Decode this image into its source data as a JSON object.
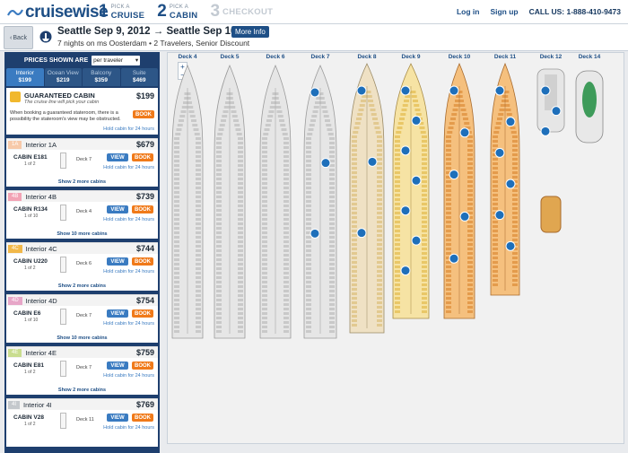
{
  "brand": {
    "logo_text": "cruisewise",
    "accent": "#1e4f86",
    "book_color": "#f07a1a"
  },
  "steps": [
    {
      "num": "1",
      "small": "PICK A",
      "big": "CRUISE"
    },
    {
      "num": "2",
      "small": "PICK A",
      "big": "CABIN"
    },
    {
      "num": "3",
      "small": "",
      "big": "CHECKOUT"
    }
  ],
  "top_links": {
    "login": "Log in",
    "signup": "Sign up",
    "phone": "CALL US: 1-888-410-9473"
  },
  "trip": {
    "back_label": "Back",
    "title": "Seattle Sep 9, 2012 → Seattle Sep 16, 2012",
    "more_info": "More Info",
    "subtitle": "7 nights on ms Oosterdam  •  2 Travelers, Senior Discount"
  },
  "sidebar": {
    "prices_label": "PRICES SHOWN ARE",
    "prices_option": "per traveler",
    "tabs": [
      {
        "name": "Interior",
        "price": "$199"
      },
      {
        "name": "Ocean View",
        "price": "$219"
      },
      {
        "name": "Balcony",
        "price": "$359"
      },
      {
        "name": "Suite",
        "price": "$469"
      }
    ],
    "guarantee": {
      "title": "GUARANTEED CABIN",
      "price": "$199",
      "subtitle": "The cruise line will pick your cabin",
      "desc": "When booking a guaranteed stateroom, there is a possibility the stateroom's view may be obstructed.",
      "book": "BOOK",
      "hold": "Hold cabin for 24 hours"
    },
    "cards": [
      {
        "code": "1A",
        "code_color": "#f7c9a9",
        "name": "Interior 1A",
        "price": "$679",
        "cabin": "CABIN E181",
        "of": "1 of 2",
        "deck": "Deck 7",
        "view": "VIEW",
        "book": "BOOK",
        "hold": "Hold cabin for 24 hours",
        "more": "Show 2 more cabins"
      },
      {
        "code": "4B",
        "code_color": "#f2a3b5",
        "name": "Interior 4B",
        "price": "$739",
        "cabin": "CABIN R134",
        "of": "1 of 10",
        "deck": "Deck 4",
        "view": "VIEW",
        "book": "BOOK",
        "hold": "Hold cabin for 24 hours",
        "more": "Show 10 more cabins"
      },
      {
        "code": "4C",
        "code_color": "#f1b84a",
        "name": "Interior 4C",
        "price": "$744",
        "cabin": "CABIN U220",
        "of": "1 of 2",
        "deck": "Deck 6",
        "view": "VIEW",
        "book": "BOOK",
        "hold": "Hold cabin for 24 hours",
        "more": "Show 2 more cabins"
      },
      {
        "code": "4D",
        "code_color": "#e7a6c8",
        "name": "Interior 4D",
        "price": "$754",
        "cabin": "CABIN E6",
        "of": "1 of 10",
        "deck": "Deck 7",
        "view": "VIEW",
        "book": "BOOK",
        "hold": "Hold cabin for 24 hours",
        "more": "Show 10 more cabins"
      },
      {
        "code": "4E",
        "code_color": "#c9dd8f",
        "name": "Interior 4E",
        "price": "$759",
        "cabin": "CABIN E81",
        "of": "1 of 2",
        "deck": "Deck 7",
        "view": "VIEW",
        "book": "BOOK",
        "hold": "Hold cabin for 24 hours",
        "more": "Show 2 more cabins"
      },
      {
        "code": "4I",
        "code_color": "#c4c8cc",
        "name": "Interior 4I",
        "price": "$769",
        "cabin": "CABIN V28",
        "of": "1 of 2",
        "deck": "Deck 11",
        "view": "VIEW",
        "book": "BOOK",
        "hold": "Hold cabin for 24 hours",
        "more": ""
      }
    ]
  },
  "decks": [
    {
      "label": "Deck 4",
      "style": "gray"
    },
    {
      "label": "Deck 5",
      "style": "gray"
    },
    {
      "label": "Deck 6",
      "style": "gray"
    },
    {
      "label": "Deck 7",
      "style": "gray"
    },
    {
      "label": "Deck 8",
      "style": "tan"
    },
    {
      "label": "Deck 9",
      "style": "yellow"
    },
    {
      "label": "Deck 10",
      "style": "orange"
    },
    {
      "label": "Deck 11",
      "style": "orange"
    },
    {
      "label": "Deck 12",
      "style": "gray"
    },
    {
      "label": "Deck 14",
      "style": "green"
    }
  ],
  "zoom": {
    "in": "+",
    "out": "−"
  }
}
